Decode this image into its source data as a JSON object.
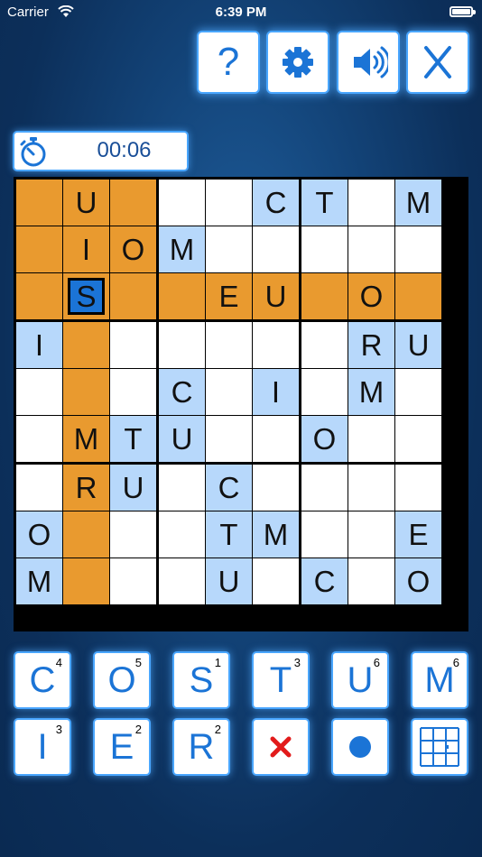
{
  "status_bar": {
    "carrier": "Carrier",
    "time": "6:39 PM"
  },
  "toolbar": {
    "help_label": "?",
    "settings_icon": "gear-icon",
    "sound_icon": "speaker-icon",
    "close_icon": "close-icon",
    "colors": {
      "icon": "#1b74d6"
    }
  },
  "timer": {
    "value": "00:06",
    "icon": "stopwatch-icon"
  },
  "colors": {
    "highlight": "#e99a2f",
    "given": "#b7d8fb",
    "empty": "#ffffff",
    "selected": "#1b74d6"
  },
  "board": {
    "rows": [
      [
        "",
        "U",
        "",
        "",
        "",
        "C",
        "T",
        "",
        "M"
      ],
      [
        "",
        "I",
        "O",
        "M",
        "",
        "",
        "",
        "",
        ""
      ],
      [
        "",
        "S",
        "",
        "",
        "E",
        "U",
        "",
        "O",
        ""
      ],
      [
        "I",
        "",
        "",
        "",
        "",
        "",
        "",
        "R",
        "U"
      ],
      [
        "",
        "",
        "",
        "C",
        "",
        "I",
        "",
        "M",
        ""
      ],
      [
        "",
        "M",
        "T",
        "U",
        "",
        "",
        "O",
        "",
        ""
      ],
      [
        "",
        "R",
        "U",
        "",
        "C",
        "",
        "",
        "",
        ""
      ],
      [
        "O",
        "",
        "",
        "",
        "T",
        "M",
        "",
        "",
        "E"
      ],
      [
        "M",
        "",
        "",
        "",
        "U",
        "",
        "C",
        "",
        "O"
      ]
    ],
    "styles": [
      [
        "o",
        "o",
        "o",
        "w",
        "w",
        "b",
        "b",
        "w",
        "b"
      ],
      [
        "o",
        "o",
        "o",
        "b",
        "w",
        "w",
        "w",
        "w",
        "w"
      ],
      [
        "o",
        "s",
        "o",
        "o",
        "o",
        "o",
        "o",
        "o",
        "o"
      ],
      [
        "b",
        "o",
        "w",
        "w",
        "w",
        "w",
        "w",
        "b",
        "b"
      ],
      [
        "w",
        "o",
        "w",
        "b",
        "w",
        "b",
        "w",
        "b",
        "w"
      ],
      [
        "w",
        "o",
        "b",
        "b",
        "w",
        "w",
        "b",
        "w",
        "w"
      ],
      [
        "w",
        "o",
        "b",
        "w",
        "b",
        "w",
        "w",
        "w",
        "w"
      ],
      [
        "b",
        "o",
        "w",
        "w",
        "b",
        "b",
        "w",
        "w",
        "b"
      ],
      [
        "b",
        "o",
        "w",
        "w",
        "b",
        "w",
        "b",
        "w",
        "b"
      ]
    ],
    "selected": {
      "row": 2,
      "col": 1,
      "letter": "S"
    }
  },
  "keys": [
    {
      "letter": "C",
      "count": "4"
    },
    {
      "letter": "O",
      "count": "5"
    },
    {
      "letter": "S",
      "count": "1"
    },
    {
      "letter": "T",
      "count": "3"
    },
    {
      "letter": "U",
      "count": "6"
    },
    {
      "letter": "M",
      "count": "6"
    },
    {
      "letter": "I",
      "count": "3"
    },
    {
      "letter": "E",
      "count": "2"
    },
    {
      "letter": "R",
      "count": "2"
    }
  ],
  "actions": {
    "erase_icon": "x-mark-icon",
    "note_icon": "dot-icon",
    "grid_icon": "mini-grid-icon"
  }
}
